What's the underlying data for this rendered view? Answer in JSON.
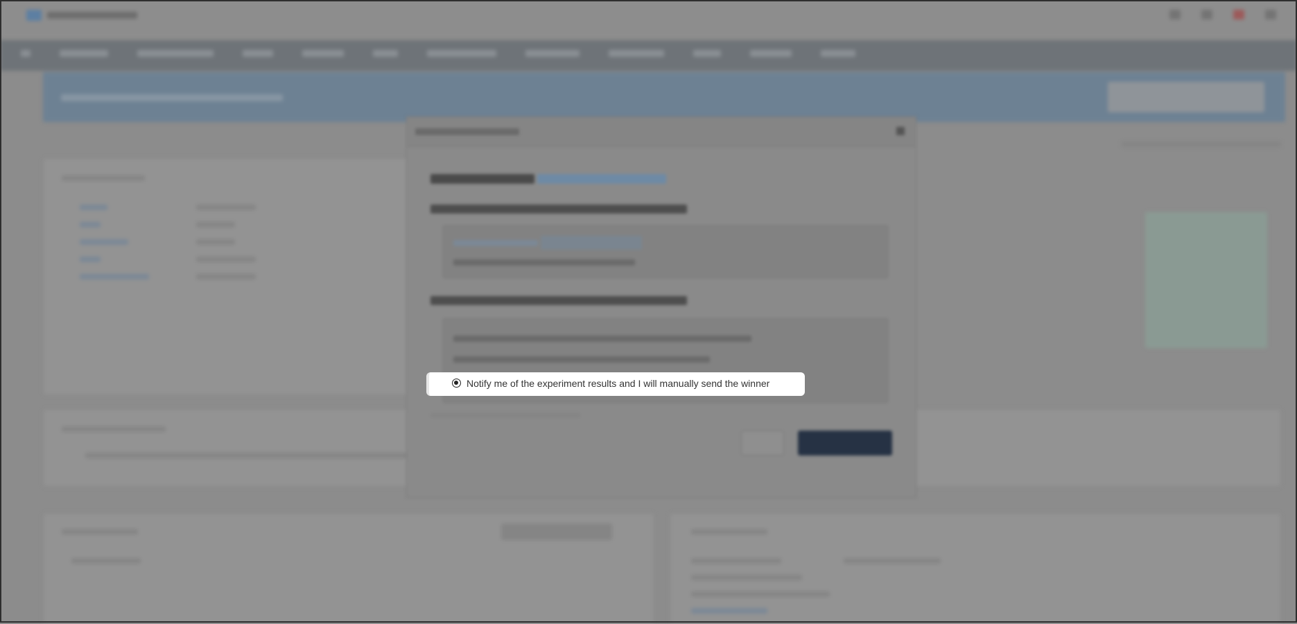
{
  "highlighted_option": {
    "selected": true,
    "label": "Notify me of the experiment results and I will manually send the winner"
  },
  "icons": {
    "radio": "radio-button-selected-icon",
    "close": "close-icon"
  },
  "colors": {
    "overlay": "#8c8c8c",
    "highlight_bg": "#ffffff",
    "primary_button": "#263244",
    "link": "#6e8aa5"
  }
}
